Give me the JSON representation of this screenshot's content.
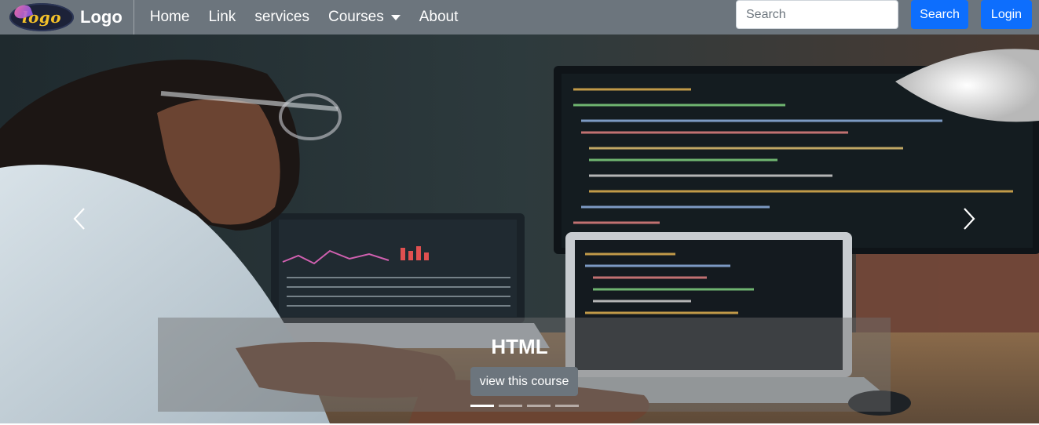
{
  "brand": {
    "logo_text": "logo",
    "name": "Logo"
  },
  "nav": {
    "items": [
      {
        "label": "Home"
      },
      {
        "label": "Link"
      },
      {
        "label": "services"
      },
      {
        "label": "Courses",
        "has_dropdown": true
      },
      {
        "label": "About"
      }
    ]
  },
  "search": {
    "placeholder": "Search",
    "button_label": "Search"
  },
  "login": {
    "label": "Login"
  },
  "carousel": {
    "caption_title": "HTML",
    "cta_label": "view this course",
    "slide_count": 4,
    "active_index": 0
  },
  "colors": {
    "navbar": "#6c757d",
    "primary": "#0d6efd",
    "secondary": "#6c757d"
  }
}
